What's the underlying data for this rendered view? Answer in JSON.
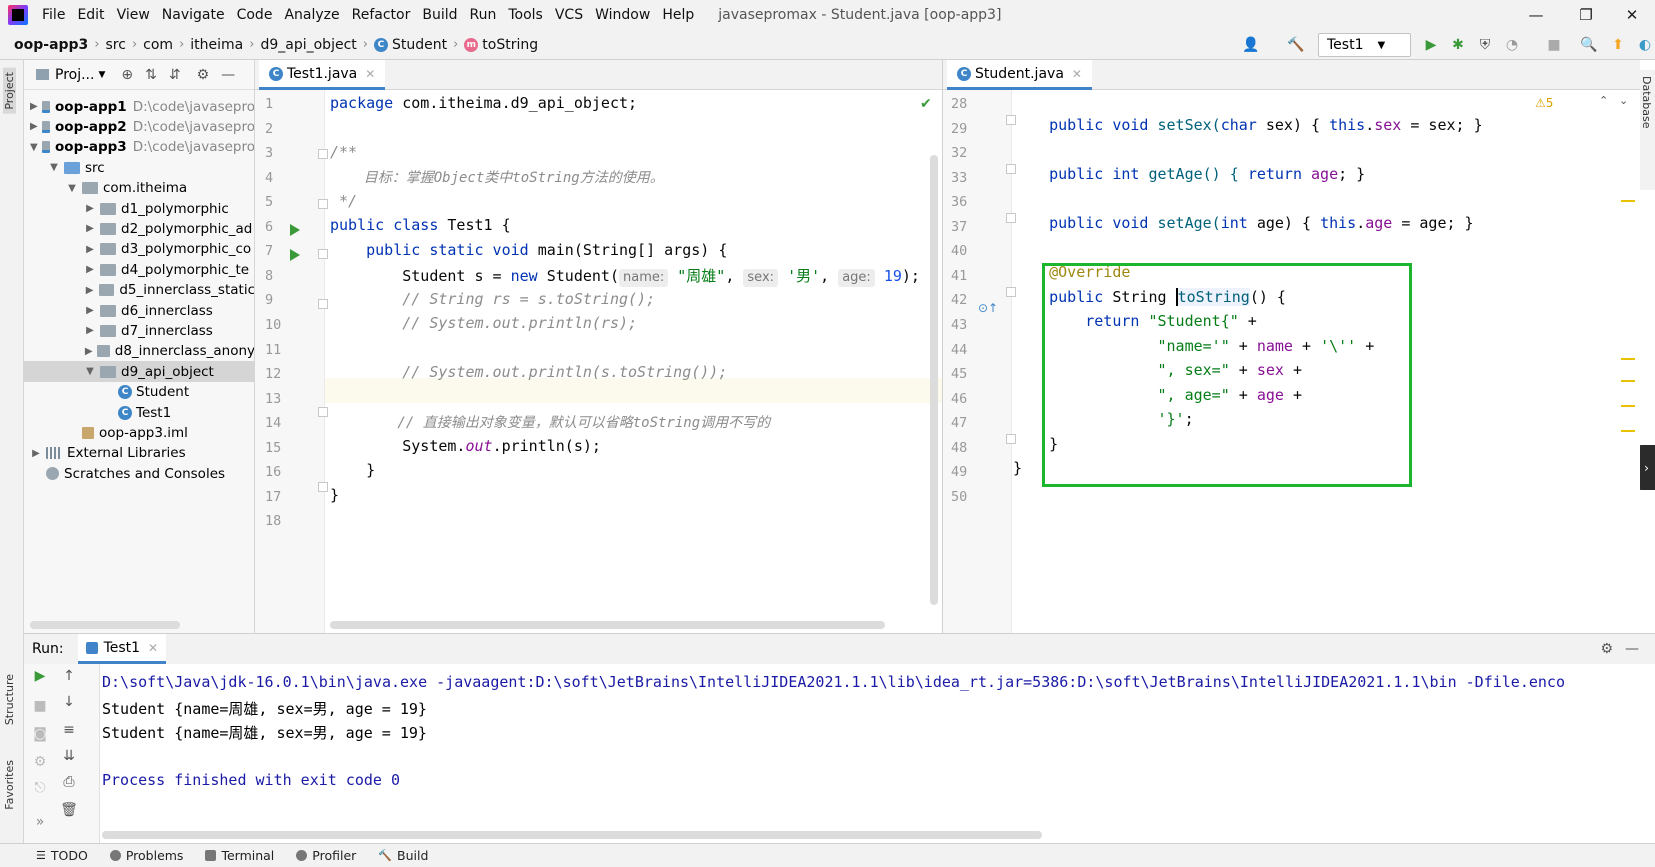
{
  "window": {
    "title": "javasepromax - Student.java [oop-app3]",
    "menu": [
      "File",
      "Edit",
      "View",
      "Navigate",
      "Code",
      "Analyze",
      "Refactor",
      "Build",
      "Run",
      "Tools",
      "VCS",
      "Window",
      "Help"
    ],
    "controls": {
      "minimize": "—",
      "maximize": "❐",
      "close": "✕"
    }
  },
  "breadcrumb": [
    "oop-app3",
    "src",
    "com",
    "itheima",
    "d9_api_object",
    "Student",
    "toString"
  ],
  "toolbar": {
    "run_config": "Test1"
  },
  "left_strip": {
    "project": "Project",
    "structure": "Structure",
    "favorites": "Favorites"
  },
  "right_strip": {
    "database": "Database"
  },
  "project_panel": {
    "title": "Proj...",
    "tree": [
      {
        "label": "oop-app1",
        "path": "D:\\code\\javasepro",
        "bold": true,
        "indent": 0,
        "arrow": "▶",
        "icon": "module"
      },
      {
        "label": "oop-app2",
        "path": "D:\\code\\javasepro",
        "bold": true,
        "indent": 0,
        "arrow": "▶",
        "icon": "module"
      },
      {
        "label": "oop-app3",
        "path": "D:\\code\\javasepro",
        "bold": true,
        "indent": 0,
        "arrow": "▼",
        "icon": "module"
      },
      {
        "label": "src",
        "indent": 1,
        "arrow": "▼",
        "icon": "folder-blue"
      },
      {
        "label": "com.itheima",
        "indent": 2,
        "arrow": "▼",
        "icon": "folder"
      },
      {
        "label": "d1_polymorphic",
        "indent": 3,
        "arrow": "▶",
        "icon": "folder"
      },
      {
        "label": "d2_polymorphic_ad",
        "indent": 3,
        "arrow": "▶",
        "icon": "folder"
      },
      {
        "label": "d3_polymorphic_co",
        "indent": 3,
        "arrow": "▶",
        "icon": "folder"
      },
      {
        "label": "d4_polymorphic_te",
        "indent": 3,
        "arrow": "▶",
        "icon": "folder"
      },
      {
        "label": "d5_innerclass_static",
        "indent": 3,
        "arrow": "▶",
        "icon": "folder"
      },
      {
        "label": "d6_innerclass",
        "indent": 3,
        "arrow": "▶",
        "icon": "folder"
      },
      {
        "label": "d7_innerclass",
        "indent": 3,
        "arrow": "▶",
        "icon": "folder"
      },
      {
        "label": "d8_innerclass_anony",
        "indent": 3,
        "arrow": "▶",
        "icon": "folder"
      },
      {
        "label": "d9_api_object",
        "indent": 3,
        "arrow": "▼",
        "icon": "folder",
        "selected": true
      },
      {
        "label": "Student",
        "indent": 4,
        "arrow": "",
        "icon": "class"
      },
      {
        "label": "Test1",
        "indent": 4,
        "arrow": "",
        "icon": "class"
      },
      {
        "label": "oop-app3.iml",
        "indent": 2,
        "arrow": "",
        "icon": "iml"
      },
      {
        "label": "External Libraries",
        "indent": 0,
        "arrow": "▶",
        "icon": "lib"
      },
      {
        "label": "Scratches and Consoles",
        "indent": 0,
        "arrow": "",
        "icon": "scratch"
      }
    ]
  },
  "left_editor": {
    "tab": "Test1.java",
    "line_numbers": [
      "1",
      "2",
      "3",
      "4",
      "5",
      "6",
      "7",
      "8",
      "9",
      "10",
      "11",
      "12",
      "13",
      "14",
      "15",
      "16",
      "17",
      "18"
    ],
    "lines": {
      "l1a": "package",
      "l1b": " com.itheima.d9_api_object;",
      "l3": "/**",
      "l4": "    目标：掌握Object类中toString方法的使用。",
      "l5": " */",
      "l6a": "public class",
      "l6b": " Test1 {",
      "l7a": "    public static void",
      "l7b": " main(String[] args) {",
      "l8a": "        Student s = ",
      "l8b": "new",
      "l8c": " Student(",
      "l8h1": "name:",
      "l8s1": "\"周雄\"",
      "l8h2": "sex:",
      "l8s2": "'男'",
      "l8h3": "age:",
      "l8n": "19",
      "l8e": ");",
      "l9": "        // String rs = s.toString();",
      "l10": "        // System.out.println(rs);",
      "l12": "        // System.out.println(s.toString());",
      "l14": "        // 直接输出对象变量，默认可以省略toString调用不写的",
      "l15a": "        System.",
      "l15b": "out",
      "l15c": ".println(s);",
      "l16": "    }",
      "l17": "}"
    }
  },
  "right_editor": {
    "tab": "Student.java",
    "warning_count": "5",
    "line_numbers": [
      "28",
      "29",
      "32",
      "33",
      "36",
      "37",
      "40",
      "41",
      "42",
      "43",
      "44",
      "45",
      "46",
      "47",
      "48",
      "49",
      "50"
    ],
    "lines": {
      "r29a": "    public void",
      "r29b": " setSex(",
      "r29c": "char",
      "r29d": " sex) { ",
      "r29e": "this",
      "r29f": ".",
      "r29g": "sex",
      "r29h": " = sex; }",
      "r33a": "    public int",
      "r33b": " getAge() { ",
      "r33c": "return",
      "r33d": " ",
      "r33e": "age",
      "r33f": "; }",
      "r37a": "    public void",
      "r37b": " setAge(",
      "r37c": "int",
      "r37d": " age) { ",
      "r37e": "this",
      "r37f": ".",
      "r37g": "age",
      "r37h": " = age; }",
      "r41": "    @Override",
      "r42a": "    public",
      "r42b": " String ",
      "r42c": "toString",
      "r42d": "() {",
      "r43a": "        return ",
      "r43b": "\"Student{\"",
      "r43c": " +",
      "r44a": "                ",
      "r44b": "\"name='\"",
      "r44c": " + ",
      "r44d": "name",
      "r44e": " + ",
      "r44f": "'\\''",
      "r44g": " +",
      "r45a": "                ",
      "r45b": "\", sex=\"",
      "r45c": " + ",
      "r45d": "sex",
      "r45e": " +",
      "r46a": "                ",
      "r46b": "\", age=\"",
      "r46c": " + ",
      "r46d": "age",
      "r46e": " +",
      "r47a": "                ",
      "r47b": "'}'",
      "r47c": ";",
      "r48": "    }",
      "r49": "}"
    }
  },
  "run_panel": {
    "label": "Run:",
    "tab": "Test1",
    "output": [
      "D:\\soft\\Java\\jdk-16.0.1\\bin\\java.exe -javaagent:D:\\soft\\JetBrains\\IntelliJIDEA2021.1.1\\lib\\idea_rt.jar=5386:D:\\soft\\JetBrains\\IntelliJIDEA2021.1.1\\bin -Dfile.enco",
      "Student {name=周雄, sex=男, age = 19}",
      "Student {name=周雄, sex=男, age = 19}",
      "",
      "Process finished with exit code 0"
    ]
  },
  "status_bar": [
    "TODO",
    "Problems",
    "Terminal",
    "Profiler",
    "Build"
  ],
  "colors": {
    "accent": "#4083c9",
    "highlight_box": "#1cb52e",
    "run_green": "#3a9a3a"
  }
}
